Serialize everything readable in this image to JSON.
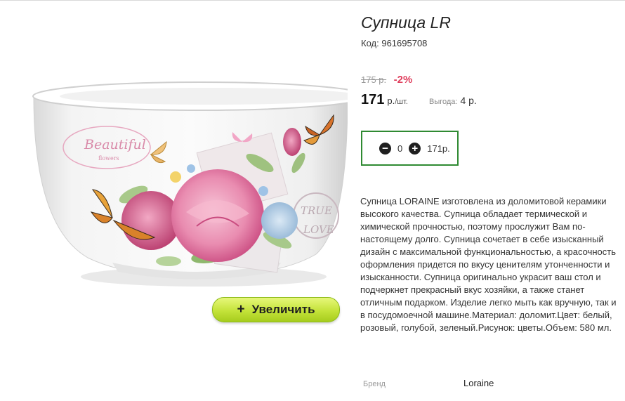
{
  "product": {
    "title": "Супница LR",
    "code_label": "Код:",
    "code": "961695708",
    "old_price": "175 р.",
    "discount": "-2%",
    "price": "171",
    "price_unit": "р.",
    "price_unit_suffix": "/шт.",
    "benefit_label": "Выгода:",
    "benefit_value": "4 р.",
    "image_labels": [
      "Beautiful",
      "flowers",
      "TRUE",
      "LOVE"
    ]
  },
  "quantity": {
    "value": "0",
    "total": "171р.",
    "minus_icon": "minus-circle-icon",
    "plus_icon": "plus-circle-icon"
  },
  "zoom": {
    "icon": "+",
    "label": "Увеличить"
  },
  "description": "Супница LORAINE изготовлена из доломитовой керамики высокого качества. Супница обладает термической и химической прочностью, поэтому прослужит Вам по-настоящему долго. Супница сочетает в себе изысканный дизайн с максимальной функциональностью, а красочность оформления придется по вкусу ценителям утонченности и изысканности. Супница оригинально украсит ваш стол и подчеркнет прекрасный вкус хозяйки, а также станет отличным подарком. Изделие легко мыть как вручную, так и в посудомоечной машине.Материал: доломит.Цвет: белый, розовый, голубой, зеленый.Рисунок: цветы.Объем: 580 мл.",
  "brand": {
    "label": "Бренд",
    "value": "Loraine"
  },
  "colors": {
    "accent_green": "#2f8a32",
    "discount_red": "#e0405e",
    "zoom_button": "#c4e33a"
  }
}
